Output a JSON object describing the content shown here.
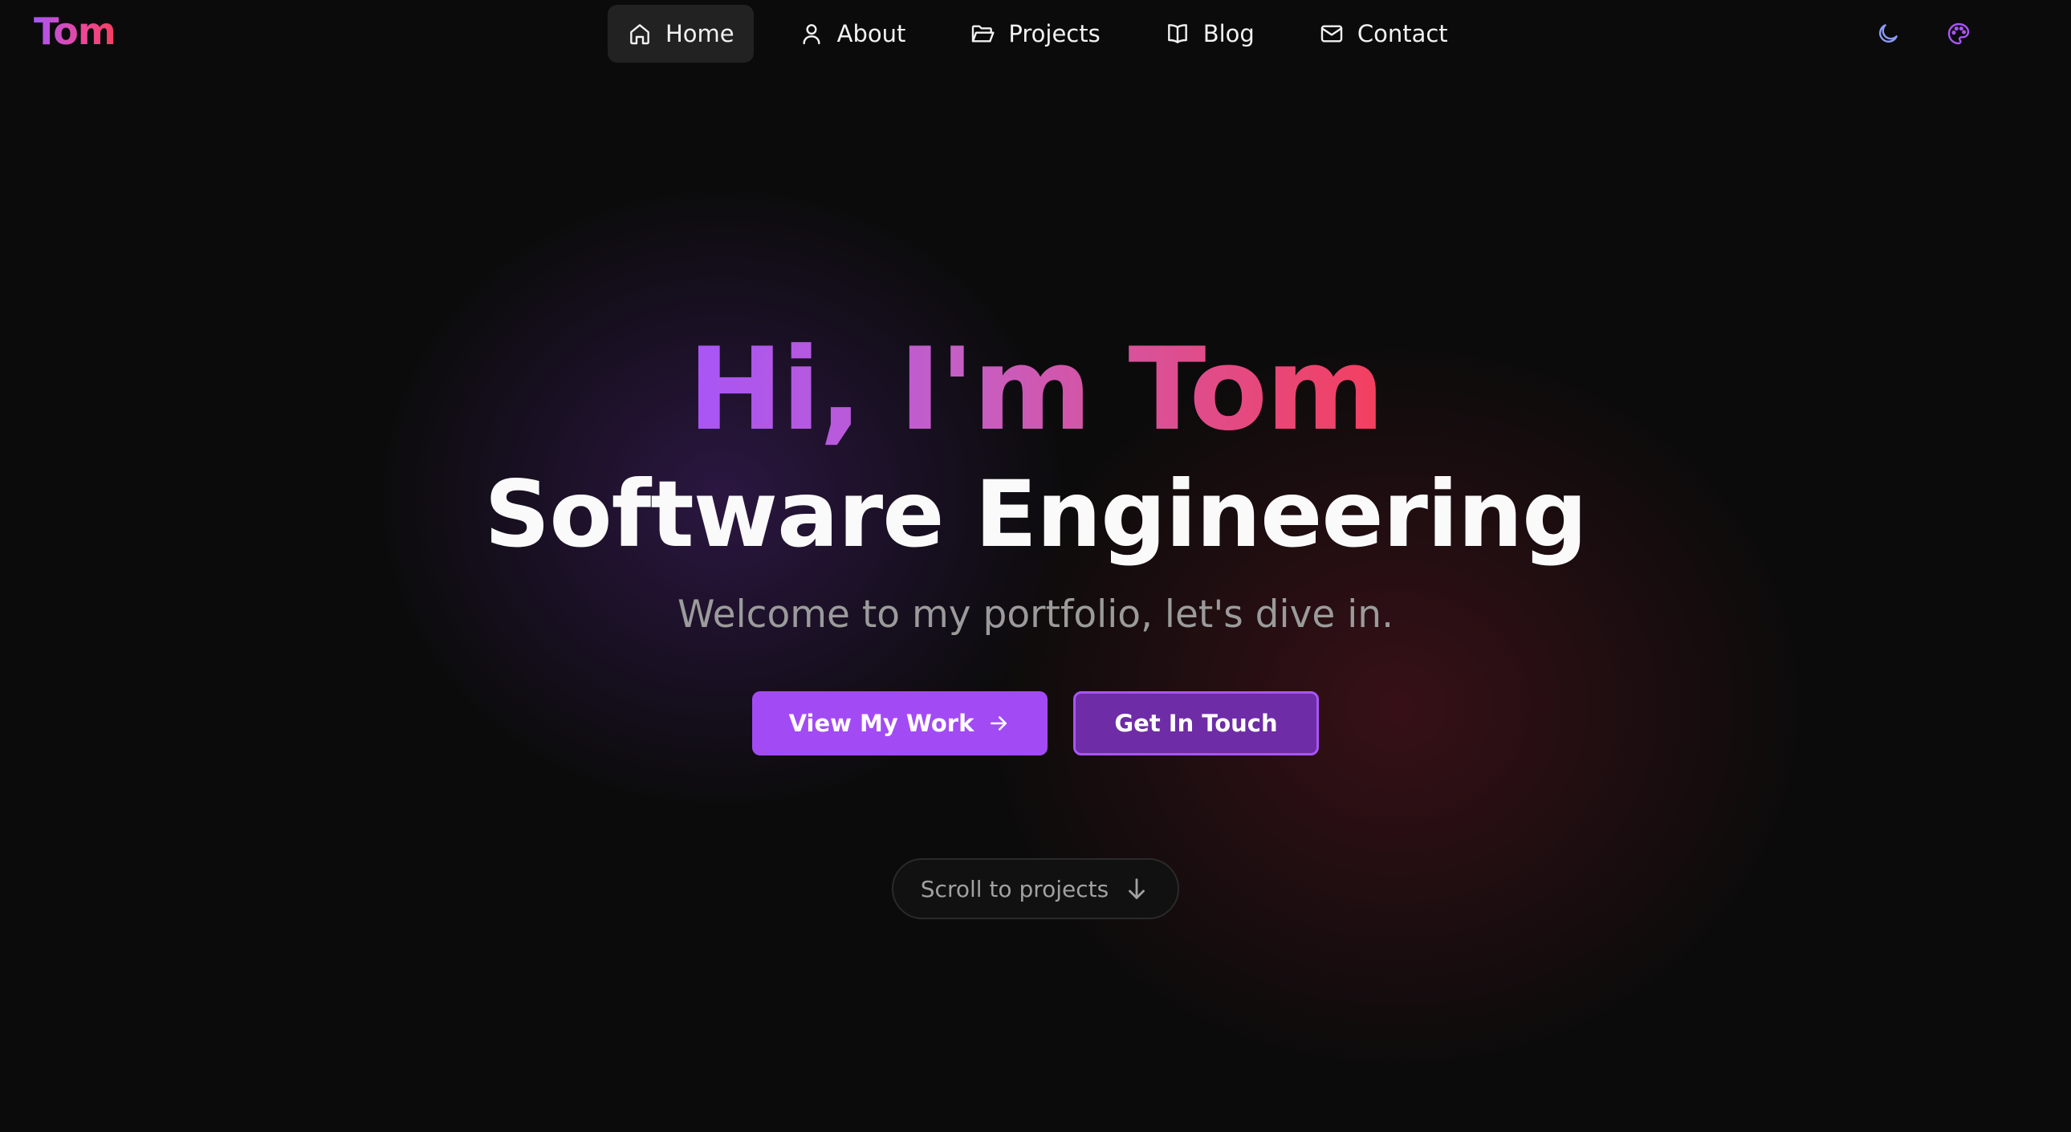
{
  "brand": {
    "logo_text": "Tom"
  },
  "nav": {
    "items": [
      {
        "label": "Home",
        "icon": "home-icon",
        "active": true
      },
      {
        "label": "About",
        "icon": "user-icon",
        "active": false
      },
      {
        "label": "Projects",
        "icon": "folder-icon",
        "active": false
      },
      {
        "label": "Blog",
        "icon": "book-icon",
        "active": false
      },
      {
        "label": "Contact",
        "icon": "mail-icon",
        "active": false
      }
    ],
    "right_icons": [
      "moon-icon",
      "palette-icon"
    ]
  },
  "hero": {
    "greeting": "Hi, I'm Tom",
    "headline": "Software Engineering",
    "tagline": "Welcome to my portfolio, let's dive in.",
    "primary_cta": "View My Work",
    "secondary_cta": "Get In Touch",
    "scroll_label": "Scroll to projects"
  },
  "colors": {
    "accent_purple": "#a855f7",
    "accent_pink": "#ec4899",
    "accent_red": "#f43f5e",
    "primary_button": "#a24bf4",
    "secondary_button": "#6e2ca6",
    "moon_icon": "#8b9cf7",
    "background": "#0b0b0b"
  }
}
